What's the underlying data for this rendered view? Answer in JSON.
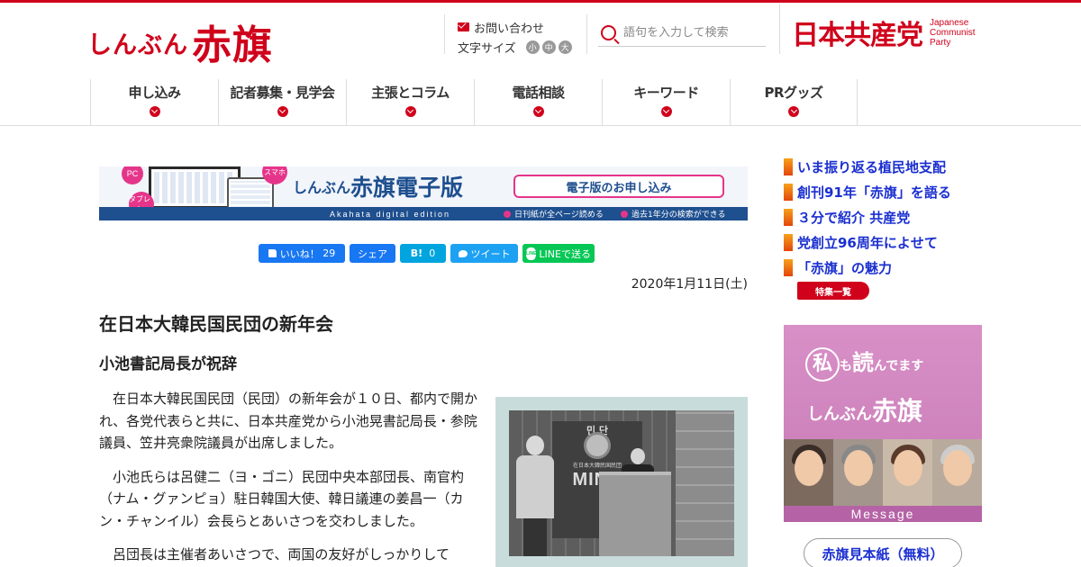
{
  "header": {
    "logo_kana": "しんぶん",
    "logo_kanji": "赤旗",
    "contact_label": "お問い合わせ",
    "font_size_label": "文字サイズ",
    "font_sizes": [
      "小",
      "中",
      "大"
    ],
    "search_placeholder": "語句を入力して検索",
    "party_name": "日本共産党",
    "party_name_en": [
      "Japanese",
      "Communist",
      "Party"
    ]
  },
  "nav": {
    "items": [
      {
        "label": "申し込み"
      },
      {
        "label": "記者募集・見学会"
      },
      {
        "label": "主張とコラム"
      },
      {
        "label": "電話相談"
      },
      {
        "label": "キーワード"
      },
      {
        "label": "PRグッズ"
      }
    ]
  },
  "banner": {
    "pc": "PC",
    "tablet": "タブレット",
    "smartphone": "スマホ",
    "title_kana": "しんぶん",
    "title_main": "赤旗電子版",
    "subtitle": "Akahata digital edition",
    "cta": "電子版のお申し込み",
    "features": [
      "日刊紙が全ページ読める",
      "過去1年分の検索ができる"
    ]
  },
  "share": {
    "like": "いいね！",
    "like_count": "29",
    "fb_share": "シェア",
    "hatena": "B!",
    "hatena_count": "0",
    "tweet": "ツイート",
    "line_logo": "LINE",
    "line": "LINEで送る"
  },
  "article": {
    "date": "2020年1月11日(土)",
    "title": "在日本大韓民国民団の新年会",
    "subtitle": "小池書記局長が祝辞",
    "paragraphs": [
      "在日本大韓民国民団（民団）の新年会が１０日、都内で開かれ、各党代表らと共に、日本共産党から小池晃書記局長・参院議員、笠井亮衆院議員が出席しました。",
      "小池氏らは呂健二（ヨ・ゴニ）民団中央本部団長、南官杓（ナム・グァンピョ）駐日韓国大使、韓日議連の姜昌一（カン・チャンイル）会長らとあいさつを交わしました。",
      "呂団長は主催者あいさつで、両国の友好がしっかりして"
    ],
    "photo": {
      "sign_top": "민  단",
      "sign_sub": "在日本大韓民国民団",
      "sign_bottom": "MIND"
    }
  },
  "sidebar": {
    "links": [
      {
        "label": "いま振り返る植民地支配"
      },
      {
        "label": "創刊91年「赤旗」を語る"
      },
      {
        "label": "３分で紹介 共産党"
      },
      {
        "label": "党創立96周年によせて"
      },
      {
        "label": "「赤旗」の魅力"
      }
    ],
    "more": "特集一覧",
    "ad": {
      "line1_a": "私",
      "line1_b": "も",
      "line1_c": "読",
      "line1_d": "んでます",
      "line2_kana": "しんぶん",
      "line2_kanji": "赤旗",
      "message": "Message"
    },
    "sample_button": "赤旗見本紙（無料）"
  },
  "colors": {
    "brand_red": "#d0021b",
    "link_blue": "#1a2fd0",
    "banner_blue": "#1e4f8f",
    "accent_pink": "#e5358a"
  }
}
